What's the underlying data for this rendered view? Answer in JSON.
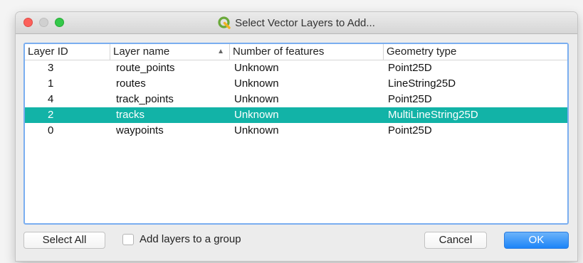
{
  "window": {
    "title": "Select Vector Layers to Add..."
  },
  "table": {
    "columns": [
      {
        "label": "Layer ID"
      },
      {
        "label": "Layer name",
        "sorted": "ascending"
      },
      {
        "label": "Number of features"
      },
      {
        "label": "Geometry type"
      }
    ],
    "rows": [
      {
        "id": "3",
        "name": "route_points",
        "features": "Unknown",
        "geometry": "Point25D",
        "selected": false
      },
      {
        "id": "1",
        "name": "routes",
        "features": "Unknown",
        "geometry": "LineString25D",
        "selected": false
      },
      {
        "id": "4",
        "name": "track_points",
        "features": "Unknown",
        "geometry": "Point25D",
        "selected": false
      },
      {
        "id": "2",
        "name": "tracks",
        "features": "Unknown",
        "geometry": "MultiLineString25D",
        "selected": true
      },
      {
        "id": "0",
        "name": "waypoints",
        "features": "Unknown",
        "geometry": "Point25D",
        "selected": false
      }
    ]
  },
  "buttons": {
    "select_all": "Select All",
    "cancel": "Cancel",
    "ok": "OK"
  },
  "options": {
    "add_to_group_label": "Add layers to a group",
    "add_to_group_checked": false
  },
  "colors": {
    "selection": "#12b3a7",
    "focus_border": "#7aaef0",
    "default_button": "#1c84f7"
  },
  "icons": {
    "app": "qgis-icon",
    "sort": "sort-ascending-icon"
  }
}
